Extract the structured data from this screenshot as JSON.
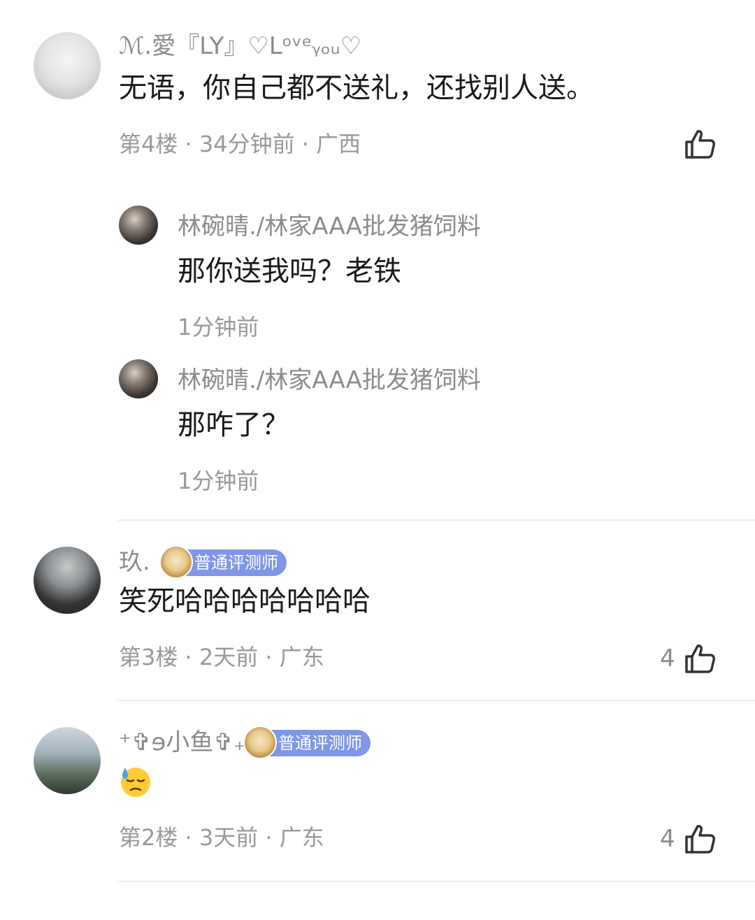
{
  "comments": [
    {
      "username": "ℳ.愛『LY』♡Lᵒᵛᵉᵧₒᵤ♡",
      "text": "无语，你自己都不送礼，还找别人送。",
      "meta": "第4楼 · 34分钟前 · 广西",
      "likes": "",
      "replies": [
        {
          "username": "林碗晴./林家AAA批发猪饲料",
          "text": "那你送我吗？老铁",
          "meta": "1分钟前"
        },
        {
          "username": "林碗晴./林家AAA批发猪饲料",
          "text": "那咋了？",
          "meta": "1分钟前"
        }
      ]
    },
    {
      "username": "玖.",
      "badge": "普通评测师",
      "text": "笑死哈哈哈哈哈哈哈",
      "meta": "第3楼 · 2天前 · 广东",
      "likes": "4"
    },
    {
      "username": "⁺✞ɘ小鱼✞₊",
      "badge": "普通评测师",
      "text": "",
      "emoji": "downcast-face-with-sweat",
      "meta": "第2楼 · 3天前 · 广东",
      "likes": "4"
    }
  ],
  "icons": {
    "like": "thumbs-up-outline-icon"
  },
  "colors": {
    "badge_bg": "#7f97e6",
    "meta_text": "#999999",
    "username_text": "#8c8c8c"
  }
}
